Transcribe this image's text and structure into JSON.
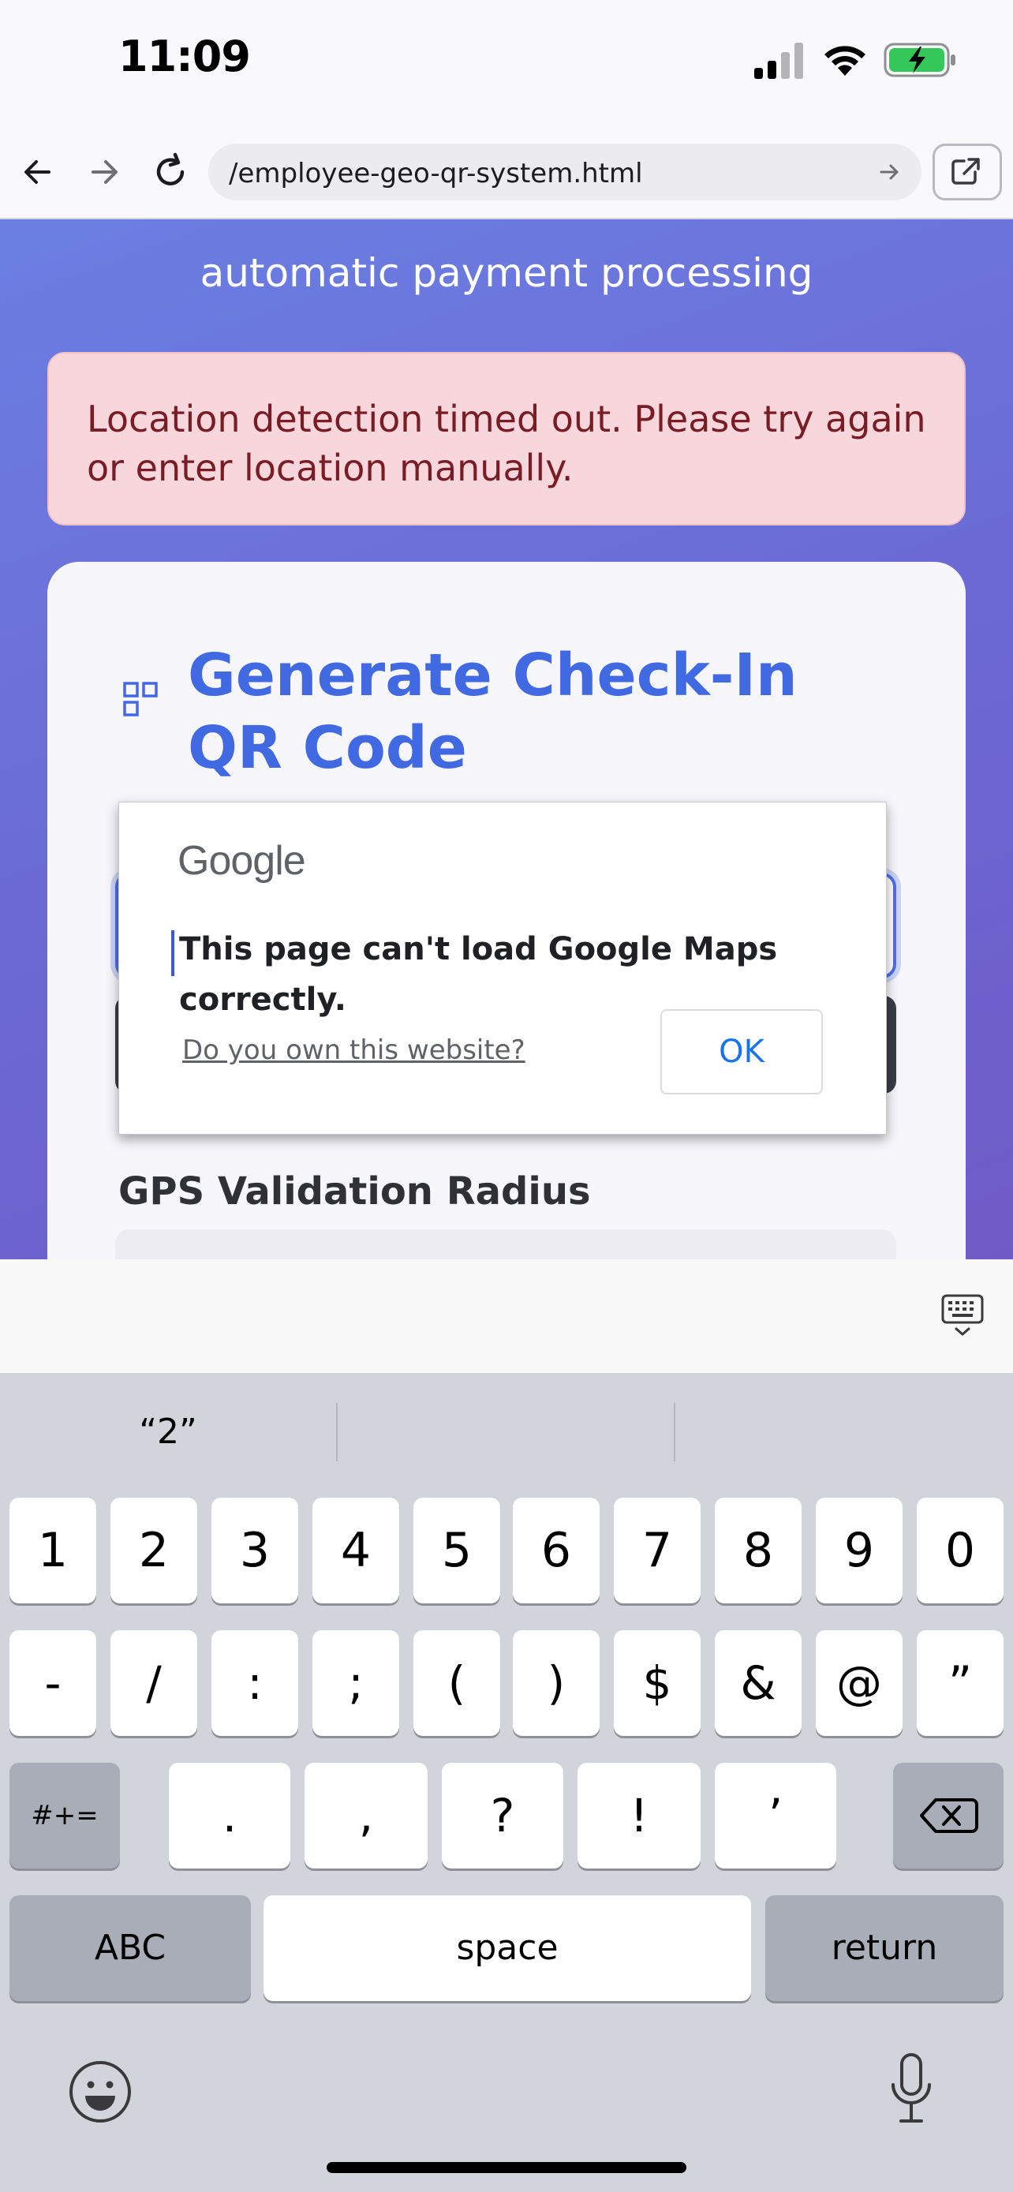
{
  "status_bar": {
    "time": "11:09"
  },
  "browser": {
    "url": "/employee-geo-qr-system.html"
  },
  "page": {
    "subtitle_line": "automatic payment processing",
    "alert_text": "Location detection timed out. Please try again or enter location manually.",
    "card_title": "Generate Check-In QR Code",
    "radius_label": "GPS Validation Radius"
  },
  "maps_dialog": {
    "brand": "Google",
    "message": "This page can't load Google Maps correctly.",
    "link": "Do you own this website?",
    "ok_label": "OK"
  },
  "keyboard": {
    "suggestions": [
      "“2”",
      "",
      ""
    ],
    "row1": [
      "1",
      "2",
      "3",
      "4",
      "5",
      "6",
      "7",
      "8",
      "9",
      "0"
    ],
    "row2": [
      "-",
      "/",
      ":",
      ";",
      "(",
      ")",
      "$",
      "&",
      "@",
      "”"
    ],
    "row3": [
      ".",
      ",",
      "?",
      "!",
      "’"
    ],
    "more_symbols": "#+=",
    "abc": "ABC",
    "space": "space",
    "return": "return"
  }
}
